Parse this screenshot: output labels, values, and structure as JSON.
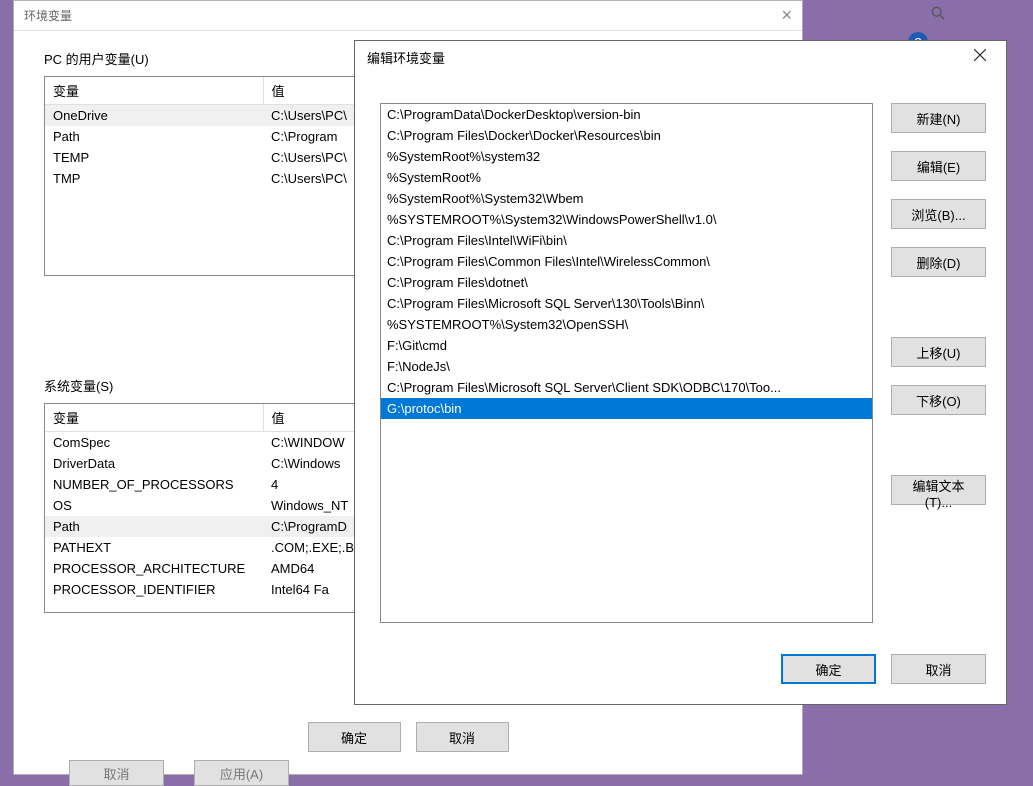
{
  "bg_dialog": {
    "title": "环境变量",
    "user_section_label": "PC 的用户变量(U)",
    "sys_section_label": "系统变量(S)",
    "col_var": "变量",
    "col_val": "值",
    "user_vars": [
      {
        "name": "OneDrive",
        "value": "C:\\Users\\PC\\"
      },
      {
        "name": "Path",
        "value": "C:\\Program "
      },
      {
        "name": "TEMP",
        "value": "C:\\Users\\PC\\"
      },
      {
        "name": "TMP",
        "value": "C:\\Users\\PC\\"
      }
    ],
    "sys_vars": [
      {
        "name": "ComSpec",
        "value": "C:\\WINDOW"
      },
      {
        "name": "DriverData",
        "value": "C:\\Windows"
      },
      {
        "name": "NUMBER_OF_PROCESSORS",
        "value": "4"
      },
      {
        "name": "OS",
        "value": "Windows_NT"
      },
      {
        "name": "Path",
        "value": "C:\\ProgramD"
      },
      {
        "name": "PATHEXT",
        "value": ".COM;.EXE;.B"
      },
      {
        "name": "PROCESSOR_ARCHITECTURE",
        "value": "AMD64"
      },
      {
        "name": "PROCESSOR_IDENTIFIER",
        "value": "Intel64 Fa"
      }
    ],
    "ok": "确定",
    "cancel": "取消",
    "cut_cancel": "取消",
    "cut_apply": "应用(A)"
  },
  "fg_dialog": {
    "title": "编辑环境变量",
    "paths": [
      "C:\\ProgramData\\DockerDesktop\\version-bin",
      "C:\\Program Files\\Docker\\Docker\\Resources\\bin",
      "%SystemRoot%\\system32",
      "%SystemRoot%",
      "%SystemRoot%\\System32\\Wbem",
      "%SYSTEMROOT%\\System32\\WindowsPowerShell\\v1.0\\",
      "C:\\Program Files\\Intel\\WiFi\\bin\\",
      "C:\\Program Files\\Common Files\\Intel\\WirelessCommon\\",
      "C:\\Program Files\\dotnet\\",
      "C:\\Program Files\\Microsoft SQL Server\\130\\Tools\\Binn\\",
      "%SYSTEMROOT%\\System32\\OpenSSH\\",
      "F:\\Git\\cmd",
      "F:\\NodeJs\\",
      "C:\\Program Files\\Microsoft SQL Server\\Client SDK\\ODBC\\170\\Too...",
      "G:\\protoc\\bin"
    ],
    "selected_index": 14,
    "btn_new": "新建(N)",
    "btn_edit": "编辑(E)",
    "btn_browse": "浏览(B)...",
    "btn_delete": "删除(D)",
    "btn_up": "上移(U)",
    "btn_down": "下移(O)",
    "btn_edittext": "编辑文本(T)...",
    "ok": "确定",
    "cancel": "取消"
  },
  "badge": "?"
}
